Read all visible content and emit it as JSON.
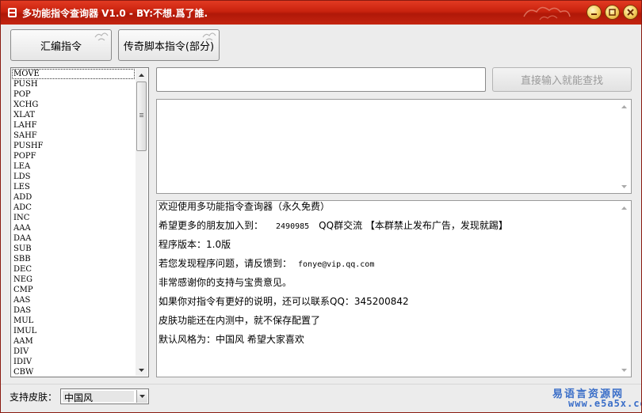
{
  "window": {
    "title": "多功能指令查询器 V1.0  -  BY:不想.爲了誰.",
    "accent": "#c8220e",
    "controls": [
      "minimize-icon",
      "maximize-icon",
      "close-icon"
    ]
  },
  "toolbar": {
    "asm_button": "汇编指令",
    "legend_button": "传奇脚本指令(部分)"
  },
  "instruction_list": {
    "selected": "MOVE",
    "items": [
      "MOVE",
      "PUSH",
      "POP",
      "XCHG",
      "XLAT",
      "LAHF",
      "SAHF",
      "PUSHF",
      "POPF",
      "LEA",
      "LDS",
      "LES",
      "ADD",
      "ADC",
      "INC",
      "AAA",
      "DAA",
      "SUB",
      "SBB",
      "DEC",
      "NEG",
      "CMP",
      "AAS",
      "DAS",
      "MUL",
      "IMUL",
      "AAM",
      "DIV",
      "IDIV",
      "CBW"
    ]
  },
  "search": {
    "value": "",
    "button_label": "直接输入就能查找"
  },
  "description": {
    "text": ""
  },
  "info": {
    "line1": "欢迎使用多功能指令查询器（永久免费）",
    "line2_prefix": "希望更多的朋友加入到：",
    "line2_qq": "2490985",
    "line2_suffix": "QQ群交流 【本群禁止发布广告，发现就踢】",
    "line3": "程序版本：1.0版",
    "line4_prefix": "若您发现程序问题，请反馈到：",
    "line4_email": "fonye@vip.qq.com",
    "line5": "非常感谢你的支持与宝贵意见。",
    "line6": "如果你对指令有更好的说明，还可以联系QQ：345200842",
    "line7": "皮肤功能还在内测中，就不保存配置了",
    "line8": "默认风格为：中国风 希望大家喜欢"
  },
  "skin": {
    "label": "支持皮肤：",
    "value": "中国风"
  },
  "watermark": {
    "line1": "易语言资源网",
    "line2": "www.e5a5x.com"
  }
}
